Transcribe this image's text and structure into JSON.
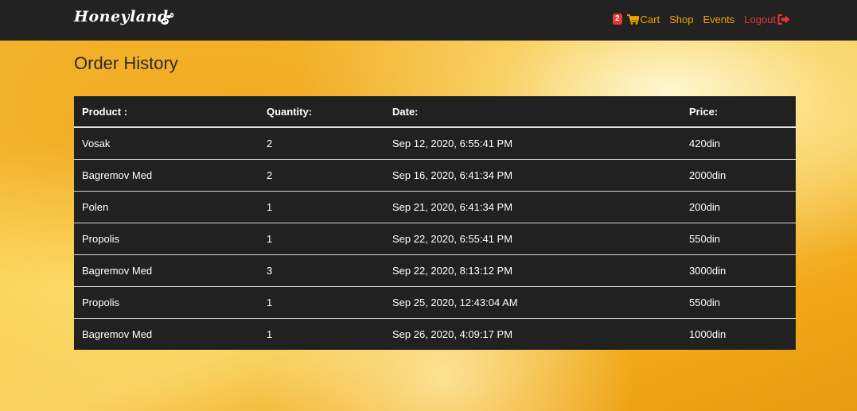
{
  "navbar": {
    "brand": "Honeyland",
    "cart_count": "2",
    "links": {
      "cart": "Cart",
      "shop": "Shop",
      "events": "Events",
      "logout": "Logout"
    }
  },
  "page": {
    "title": "Order History"
  },
  "table": {
    "headers": {
      "product": "Product :",
      "quantity": "Quantity:",
      "date": "Date:",
      "price": "Price:"
    },
    "rows": [
      {
        "product": "Vosak",
        "quantity": "2",
        "date": "Sep 12, 2020, 6:55:41 PM",
        "price": "420din"
      },
      {
        "product": "Bagremov Med",
        "quantity": "2",
        "date": "Sep 16, 2020, 6:41:34 PM",
        "price": "2000din"
      },
      {
        "product": "Polen",
        "quantity": "1",
        "date": "Sep 21, 2020, 6:41:34 PM",
        "price": "200din"
      },
      {
        "product": "Propolis",
        "quantity": "1",
        "date": "Sep 22, 2020, 6:55:41 PM",
        "price": "550din"
      },
      {
        "product": "Bagremov Med",
        "quantity": "3",
        "date": "Sep 22, 2020, 8:13:12 PM",
        "price": "3000din"
      },
      {
        "product": "Propolis",
        "quantity": "1",
        "date": "Sep 25, 2020, 12:43:04 AM",
        "price": "550din"
      },
      {
        "product": "Bagremov Med",
        "quantity": "1",
        "date": "Sep 26, 2020, 4:09:17 PM",
        "price": "1000din"
      }
    ]
  },
  "colors": {
    "accent": "#f0a500",
    "logout": "#e53935",
    "navbar": "#222222",
    "table": "#212121"
  },
  "icons": {
    "brand": "bee-icon",
    "cart": "cart-icon",
    "logout": "logout-icon"
  }
}
